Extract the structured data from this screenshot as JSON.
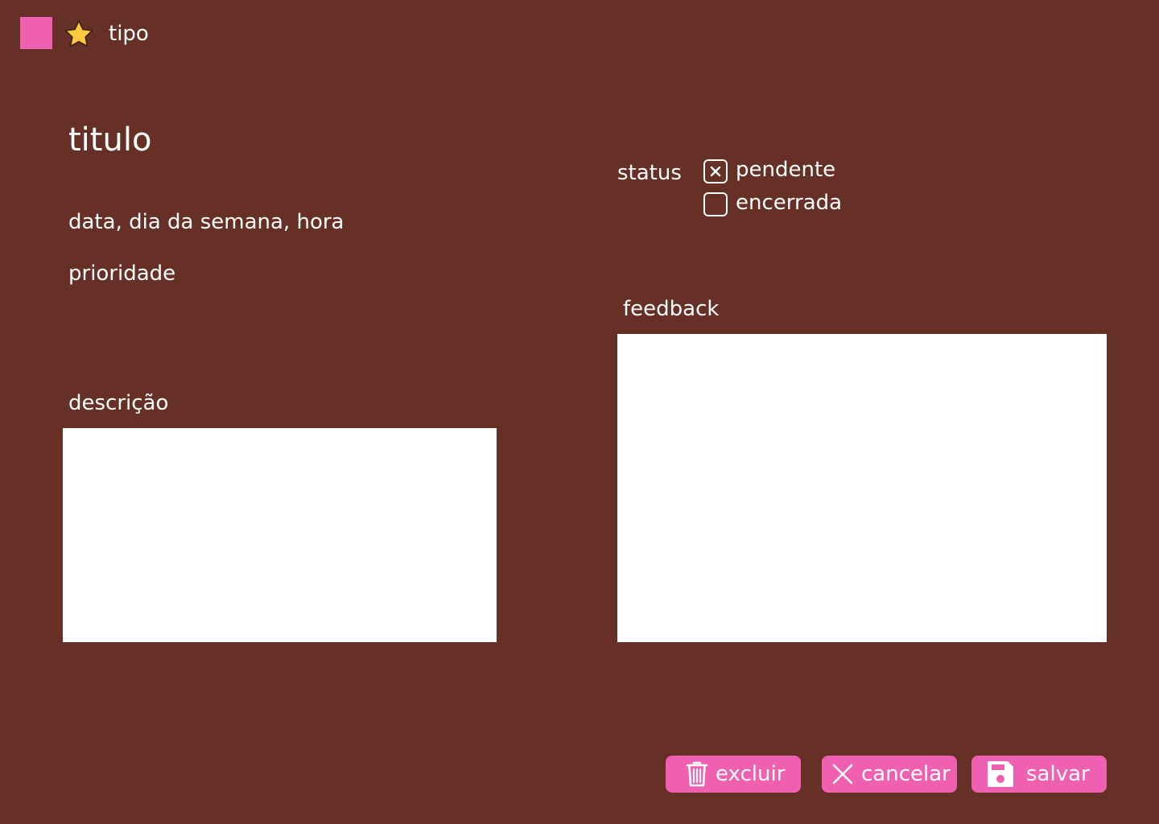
{
  "header": {
    "type_label": "tipo",
    "type_color": "#f060b0",
    "type_icon": "star-icon"
  },
  "task": {
    "title": "titulo",
    "datetime": "data, dia da semana, hora",
    "priority": "prioridade",
    "description_label": "descrição",
    "description_value": ""
  },
  "status": {
    "label": "status",
    "options": [
      {
        "label": "pendente",
        "checked": true
      },
      {
        "label": "encerrada",
        "checked": false
      }
    ]
  },
  "feedback": {
    "label": "feedback",
    "value": ""
  },
  "actions": {
    "delete_label": "excluir",
    "cancel_label": "cancelar",
    "save_label": "salvar"
  },
  "colors": {
    "background": "#663026",
    "accent": "#f060b0",
    "star": "#ffc83d"
  }
}
